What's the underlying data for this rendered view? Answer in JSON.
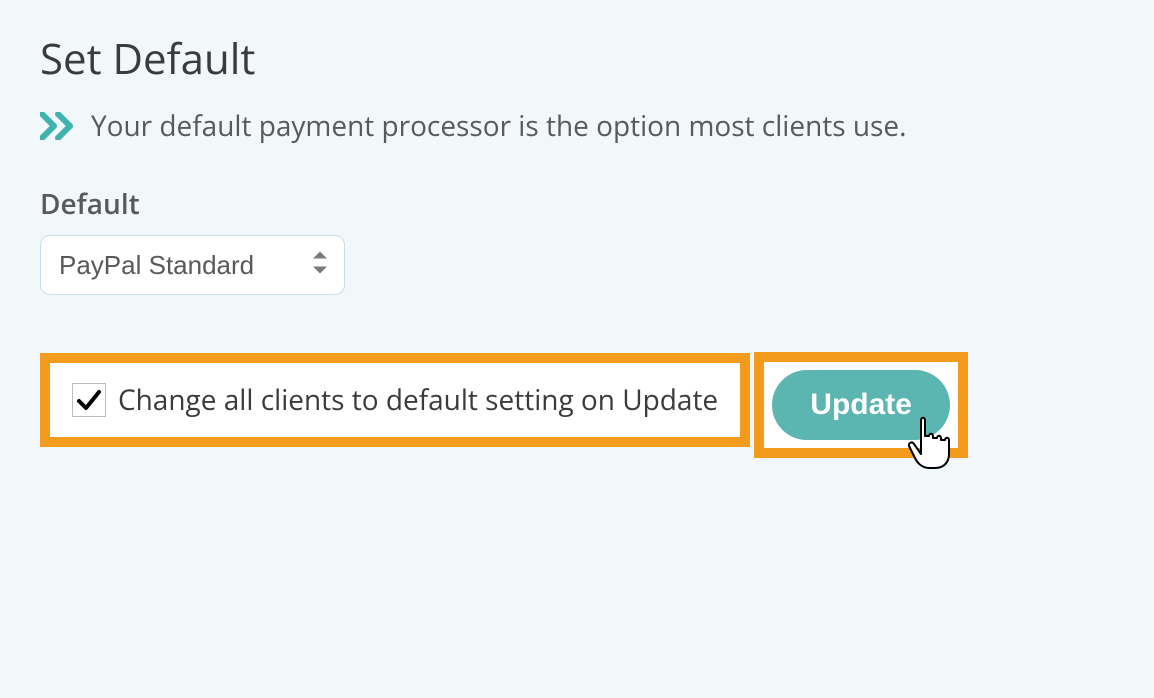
{
  "title": "Set Default",
  "description": "Your default payment processor is the option most clients use.",
  "defaultField": {
    "label": "Default",
    "selected": "PayPal Standard"
  },
  "checkbox": {
    "label": "Change all clients to default setting on Update",
    "checked": true
  },
  "updateButton": {
    "label": "Update"
  },
  "colors": {
    "accent": "#3fb3ae",
    "highlight": "#f29b1d",
    "buttonBg": "#5bb5b1"
  }
}
